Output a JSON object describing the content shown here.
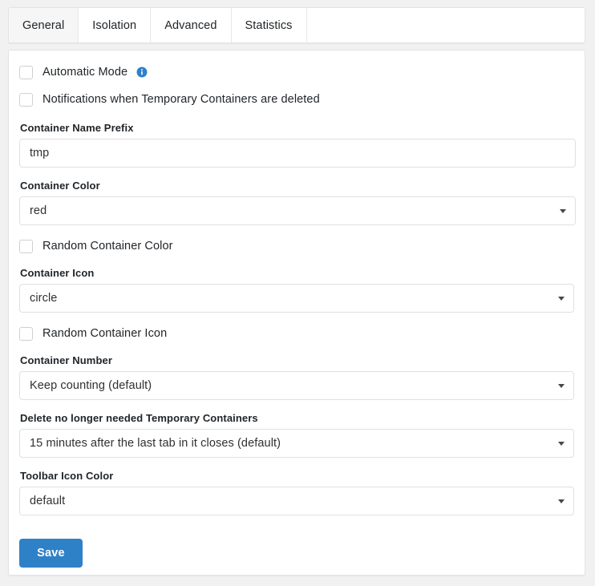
{
  "tabs": [
    {
      "label": "General",
      "active": true
    },
    {
      "label": "Isolation",
      "active": false
    },
    {
      "label": "Advanced",
      "active": false
    },
    {
      "label": "Statistics",
      "active": false
    }
  ],
  "checkboxes": {
    "automatic_mode": {
      "label": "Automatic Mode",
      "checked": false,
      "info_icon": "info-circle-icon"
    },
    "notifications": {
      "label": "Notifications when Temporary Containers are deleted",
      "checked": false
    },
    "random_container_color": {
      "label": "Random Container Color",
      "checked": false
    },
    "random_container_icon": {
      "label": "Random Container Icon",
      "checked": false
    }
  },
  "fields": {
    "container_name_prefix": {
      "label": "Container Name Prefix",
      "value": "tmp",
      "placeholder": ""
    },
    "container_color": {
      "label": "Container Color",
      "value": "red",
      "caret_icon": "chevron-down-icon"
    },
    "container_icon": {
      "label": "Container Icon",
      "value": "circle",
      "caret_icon": "chevron-down-icon"
    },
    "container_number": {
      "label": "Container Number",
      "value": "Keep counting (default)",
      "caret_icon": "chevron-down-icon"
    },
    "delete_containers": {
      "label": "Delete no longer needed Temporary Containers",
      "value": "15 minutes after the last tab in it closes (default)",
      "caret_icon": "chevron-down-icon"
    },
    "toolbar_icon_color": {
      "label": "Toolbar Icon Color",
      "value": "default",
      "caret_icon": "chevron-down-icon"
    }
  },
  "actions": {
    "save_label": "Save"
  },
  "colors": {
    "accent_blue": "#2f81c7",
    "info_blue": "#2f80c9",
    "panel_bg": "#ffffff",
    "page_bg": "#f1f1f1",
    "active_tab_bg": "#f6f6f6",
    "border": "#e0e0e0"
  }
}
